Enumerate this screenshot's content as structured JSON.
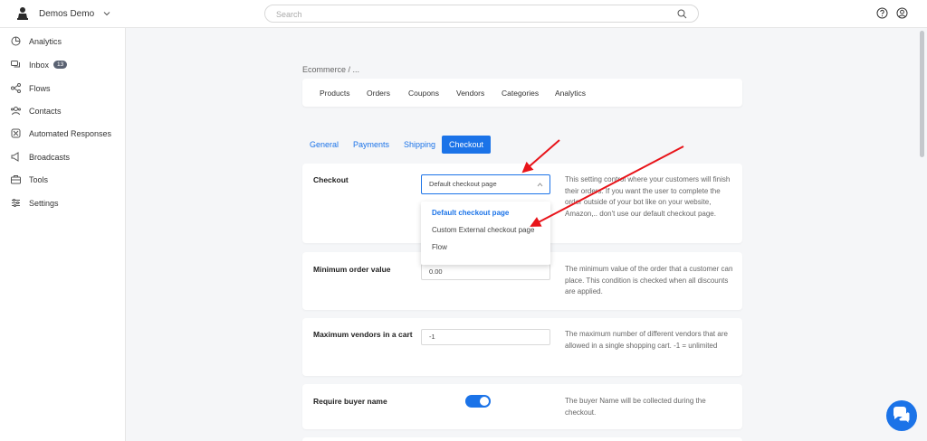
{
  "topbar": {
    "workspace_name": "Demos Demo",
    "search_placeholder": "Search"
  },
  "sidebar": {
    "items": [
      {
        "label": "Analytics",
        "icon": "analytics-icon"
      },
      {
        "label": "Inbox",
        "icon": "inbox-icon",
        "badge": "13"
      },
      {
        "label": "Flows",
        "icon": "flows-icon"
      },
      {
        "label": "Contacts",
        "icon": "contacts-icon"
      },
      {
        "label": "Automated Responses",
        "icon": "automated-responses-icon"
      },
      {
        "label": "Broadcasts",
        "icon": "broadcasts-icon"
      },
      {
        "label": "Tools",
        "icon": "tools-icon"
      },
      {
        "label": "Settings",
        "icon": "settings-icon"
      }
    ]
  },
  "breadcrumb": "Ecommerce  /  ...",
  "ecommerce_tabs": [
    "Products",
    "Orders",
    "Coupons",
    "Vendors",
    "Categories",
    "Analytics"
  ],
  "settings_tabs": [
    "General",
    "Payments",
    "Shipping",
    "Checkout"
  ],
  "active_settings_tab": "Checkout",
  "settings": {
    "checkout": {
      "title": "Checkout",
      "selected": "Default checkout page",
      "description": "This setting control where your customers will finish their orders. If you want the user to complete the order outside of your bot like on your website, Amazon,.. don't use our default checkout page.",
      "options": [
        "Default checkout page",
        "Custom External checkout page",
        "Flow"
      ]
    },
    "min_order": {
      "title": "Minimum order value",
      "value": "0.00",
      "description": "The minimum value of the order that a customer can place. This condition is checked when all discounts are applied."
    },
    "max_vendors": {
      "title": "Maximum vendors in a cart",
      "value": "-1",
      "description": "The maximum number of different vendors that are allowed in a single shopping cart. -1 = unlimited"
    },
    "require_name": {
      "title": "Require buyer name",
      "enabled": true,
      "description": "The buyer Name will be collected during the checkout."
    }
  },
  "colors": {
    "accent": "#1b73e8",
    "annotation_arrow": "#e8141a"
  }
}
